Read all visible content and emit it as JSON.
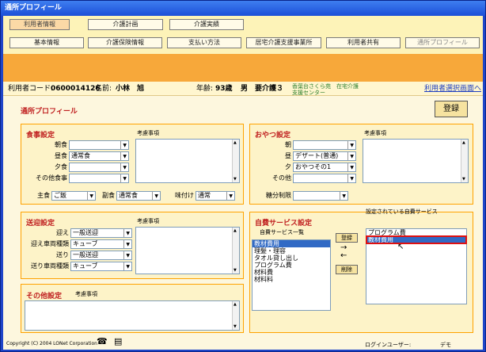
{
  "window": {
    "title": "通所プロフィール"
  },
  "nav1": [
    "利用者情報",
    "介護計画",
    "介護実績"
  ],
  "nav2": [
    "基本情報",
    "介護保険情報",
    "支払い方法",
    "居宅介護支援事業所",
    "利用者共有",
    "通所プロフィール"
  ],
  "user": {
    "code_label": "利用者コード:",
    "code": "0600014126",
    "name_label": "名前:",
    "name": "小林　旭",
    "age_label": "年齢:",
    "age": "93歳",
    "gender": "男",
    "care_level": "要介護３",
    "facility": "香葉台さくら苑　在宅介護支援センター",
    "select_link": "利用者選択画面へ"
  },
  "page": {
    "title": "通所プロフィール",
    "register": "登録"
  },
  "meal": {
    "title": "食事設定",
    "memo_label": "考慮事項",
    "rows": [
      {
        "label": "朝食",
        "value": ""
      },
      {
        "label": "昼食",
        "value": "通常食"
      },
      {
        "label": "夕食",
        "value": ""
      },
      {
        "label": "その他食事",
        "value": ""
      }
    ],
    "main_label": "主食",
    "main_value": "ご飯",
    "side_label": "副食",
    "side_value": "通常食",
    "taste_label": "味付け",
    "taste_value": "通常"
  },
  "snack": {
    "title": "おやつ設定",
    "memo_label": "考慮事項",
    "rows": [
      {
        "label": "朝",
        "value": ""
      },
      {
        "label": "昼",
        "value": "デザート(普通)"
      },
      {
        "label": "夕",
        "value": "おやつその1"
      },
      {
        "label": "その他",
        "value": ""
      }
    ],
    "sugar_label": "糖分制限",
    "sugar_value": ""
  },
  "transport": {
    "title": "送迎設定",
    "memo_label": "考慮事項",
    "rows": [
      {
        "label": "迎え",
        "value": "一般送迎"
      },
      {
        "label": "迎え車両種類",
        "value": "キューブ"
      },
      {
        "label": "送り",
        "value": "一般送迎"
      },
      {
        "label": "送り車両種類",
        "value": "キューブ"
      }
    ]
  },
  "other": {
    "title": "その他設定",
    "memo_label": "考慮事項"
  },
  "selfpay": {
    "title": "自費サービス設定",
    "list_label": "自費サービス一覧",
    "set_label": "設定されている自費サービス",
    "available": [
      "教材費用",
      "理髪・理容",
      "タオル貸し出し",
      "プログラム費",
      "材料費",
      "材料料"
    ],
    "selected": [
      "プログラム費",
      "教材費用"
    ],
    "add": "登録",
    "del": "削除"
  },
  "footer": {
    "copyright": "Copyright (C) 2004 LONet Corporation",
    "login_label": "ログインユーザー:",
    "login_user": "デモ"
  }
}
